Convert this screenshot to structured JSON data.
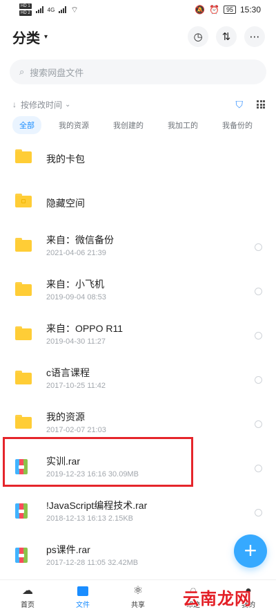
{
  "status_bar": {
    "sim1": "HD 1",
    "sim2": "HD 2",
    "network": "4G",
    "battery": "95",
    "time": "15:30"
  },
  "header": {
    "title": "分类",
    "caret": "▾"
  },
  "search": {
    "placeholder": "搜索网盘文件"
  },
  "sort": {
    "label": "按修改时间"
  },
  "tabs": [
    {
      "label": "全部"
    },
    {
      "label": "我的资源"
    },
    {
      "label": "我创建的"
    },
    {
      "label": "我加工的"
    },
    {
      "label": "我备份的"
    }
  ],
  "files": [
    {
      "name": "我的卡包",
      "meta": ""
    },
    {
      "name": "隐藏空间",
      "meta": ""
    },
    {
      "name": "来自：微信备份",
      "meta": "2021-04-06  21:39"
    },
    {
      "name": "来自：小飞机",
      "meta": "2019-09-04  08:53"
    },
    {
      "name": "来自：OPPO R11",
      "meta": "2019-04-30  11:27"
    },
    {
      "name": "c语言课程",
      "meta": "2017-10-25  11:42"
    },
    {
      "name": "我的资源",
      "meta": "2017-02-07  21:03"
    },
    {
      "name": "实训.rar",
      "meta": "2019-12-23  16:16  30.09MB"
    },
    {
      "name": "!JavaScript编程技术.rar",
      "meta": "2018-12-13  16:13  2.15KB"
    },
    {
      "name": "ps课件.rar",
      "meta": "2017-12-28  11:05  32.42MB"
    }
  ],
  "nav": [
    {
      "label": "首页"
    },
    {
      "label": "文件"
    },
    {
      "label": "共享"
    },
    {
      "label": "印迹"
    },
    {
      "label": "我的"
    }
  ],
  "watermark": "云南龙网",
  "colors": {
    "accent": "#1a8dff",
    "fab": "#36a9ff",
    "highlight": "#e5252b",
    "folder": "#ffcd36"
  }
}
